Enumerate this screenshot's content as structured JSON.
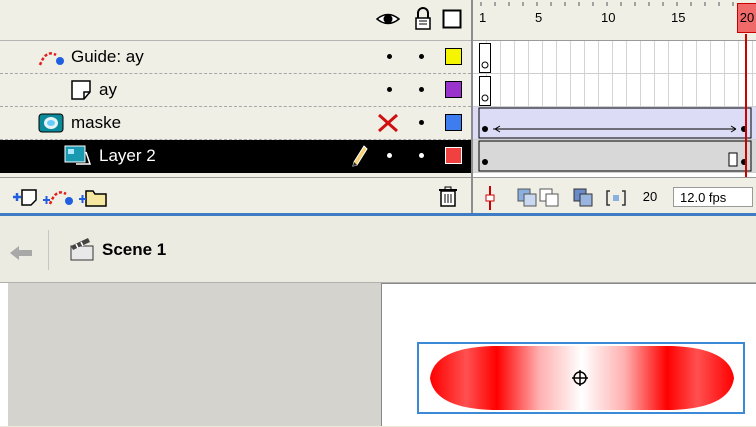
{
  "timeline": {
    "header_icons": [
      "eye-icon",
      "lock-icon",
      "outline-icon"
    ],
    "ruler_numbers": [
      "1",
      "5",
      "10",
      "15",
      "20"
    ],
    "layers": [
      {
        "name": "Guide: ay",
        "icon": "guide-layer-icon",
        "show_state": "•",
        "lock_state": "•",
        "color": "#f5f500"
      },
      {
        "name": "ay",
        "icon": "guided-layer-icon",
        "show_state": "•",
        "lock_state": "•",
        "color": "#9933cc"
      },
      {
        "name": "maske",
        "icon": "mask-layer-icon",
        "show_state": "✕",
        "lock_state": "•",
        "color": "#3d7df0"
      },
      {
        "name": "Layer 2",
        "icon": "masked-layer-icon",
        "show_state": "•",
        "lock_state": "•",
        "color": "#f04040"
      }
    ],
    "footer": {
      "current_frame": "20",
      "fps": "12.0 fps"
    }
  },
  "edit_bar": {
    "scene_name": "Scene 1"
  },
  "colors": {
    "selection": "#000000",
    "separator": "#3e7dc3",
    "playhead": "#cc0000",
    "shape_red": "#ff0000"
  }
}
